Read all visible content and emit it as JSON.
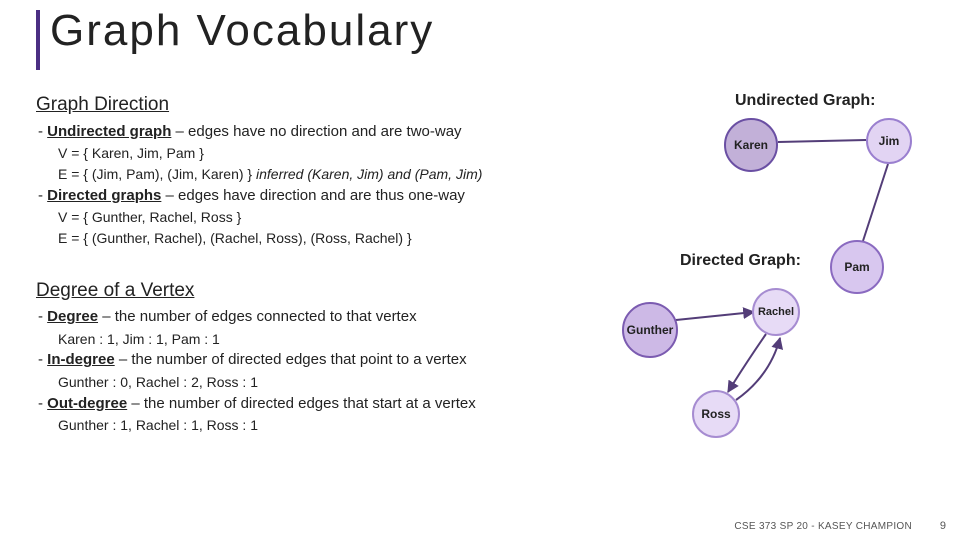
{
  "title": "Graph Vocabulary",
  "direction": {
    "heading": "Graph Direction",
    "und_term": "Undirected graph",
    "und_def": " – edges have no direction and are two-way",
    "und_V": "V = { Karen, Jim, Pam }",
    "und_E_a": "E = { (Jim, Pam), (Jim, Karen) } ",
    "und_E_b": "inferred (Karen, Jim) and (Pam, Jim)",
    "dir_term": "Directed graphs",
    "dir_def": " – edges have direction and are thus one-way",
    "dir_V": "V = { Gunther, Rachel, Ross }",
    "dir_E": "E = { (Gunther, Rachel), (Rachel, Ross), (Ross, Rachel) }"
  },
  "degree": {
    "heading": "Degree of a Vertex",
    "deg_term": "Degree",
    "deg_def": " – the number of edges connected to that vertex",
    "deg_ex": "Karen : 1, Jim : 1, Pam : 1",
    "in_term": "In-degree",
    "in_def": " – the number of directed edges that point to a vertex",
    "in_ex": "Gunther : 0, Rachel : 2, Ross : 1",
    "out_term": "Out-degree",
    "out_def": " – the number of directed edges that start at a vertex",
    "out_ex": "Gunther : 1, Rachel : 1, Ross : 1"
  },
  "labels": {
    "undirected_graph": "Undirected Graph:",
    "directed_graph": "Directed Graph:",
    "karen": "Karen",
    "jim": "Jim",
    "pam": "Pam",
    "gunther": "Gunther",
    "rachel": "Rachel",
    "ross": "Ross"
  },
  "footer": "CSE 373 SP 20 - KASEY CHAMPION",
  "page": "9",
  "chart_data": [
    {
      "type": "graph",
      "title": "Undirected Graph",
      "directed": false,
      "nodes": [
        "Karen",
        "Jim",
        "Pam"
      ],
      "edges": [
        [
          "Jim",
          "Pam"
        ],
        [
          "Jim",
          "Karen"
        ]
      ]
    },
    {
      "type": "graph",
      "title": "Directed Graph",
      "directed": true,
      "nodes": [
        "Gunther",
        "Rachel",
        "Ross"
      ],
      "edges": [
        [
          "Gunther",
          "Rachel"
        ],
        [
          "Rachel",
          "Ross"
        ],
        [
          "Ross",
          "Rachel"
        ]
      ]
    }
  ]
}
